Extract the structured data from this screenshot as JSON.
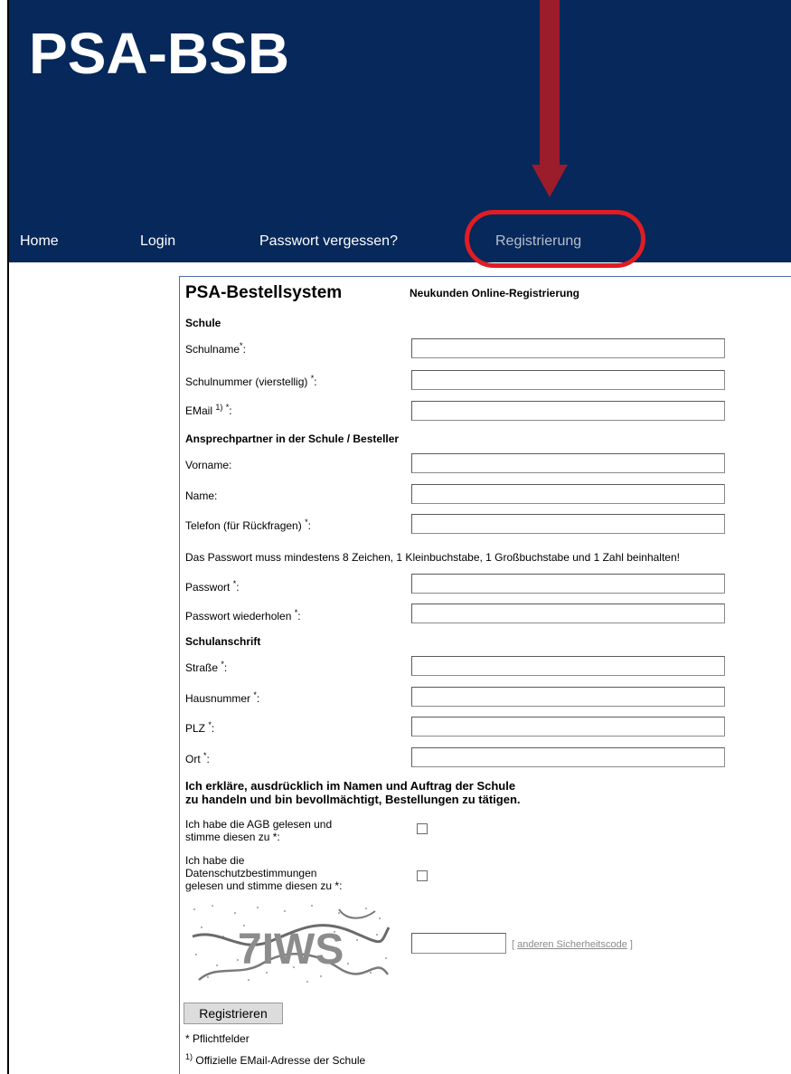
{
  "header": {
    "logo": "PSA-BSB",
    "bg_color": "#06285a",
    "nav": [
      {
        "label": "Home"
      },
      {
        "label": "Login"
      },
      {
        "label": "Passwort vergessen?"
      },
      {
        "label": "Registrierung",
        "active": true
      }
    ]
  },
  "annotation": {
    "arrow_color": "#9b1c2b",
    "ellipse_color": "#e01c24"
  },
  "form": {
    "title": "PSA-Bestellsystem",
    "subtitle": "Neukunden Online-Registrierung",
    "sections": {
      "schule": "Schule",
      "ansprechpartner": "Ansprechpartner in der Schule / Besteller",
      "schulanschrift": "Schulanschrift"
    },
    "fields": {
      "schulname": {
        "label": "Schulname",
        "value": ""
      },
      "schulnummer": {
        "label": "Schulnummer (vierstellig)",
        "value": ""
      },
      "email": {
        "label": "EMail",
        "value": ""
      },
      "vorname": {
        "label": "Vorname:",
        "value": ""
      },
      "name": {
        "label": "Name:",
        "value": ""
      },
      "telefon": {
        "label": "Telefon (für Rückfragen)",
        "value": ""
      },
      "passwort": {
        "label": "Passwort",
        "value": ""
      },
      "passwort2": {
        "label": "Passwort wiederholen",
        "value": ""
      },
      "strasse": {
        "label": "Straße",
        "value": ""
      },
      "hausnummer": {
        "label": "Hausnummer",
        "value": ""
      },
      "plz": {
        "label": "PLZ",
        "value": ""
      },
      "ort": {
        "label": "Ort",
        "value": ""
      }
    },
    "required_marker": "*",
    "email_footnote_ref": "1)",
    "password_hint": "Das Passwort muss mindestens 8 Zeichen, 1 Kleinbuchstabe, 1 Großbuchstabe und 1 Zahl beinhalten!",
    "declaration": {
      "line1": "Ich erkläre, ausdrücklich im Namen und Auftrag der Schule",
      "line2": "zu handeln und bin bevollmächtigt, Bestellungen zu tätigen."
    },
    "agb": {
      "line1": "Ich habe die AGB gelesen und",
      "line2": "stimme diesen zu *:",
      "checked": false
    },
    "datenschutz": {
      "line1": "Ich habe die",
      "line2": "Datenschutzbestimmungen",
      "line3": "gelesen und stimme diesen zu *:",
      "checked": false
    },
    "captcha": {
      "code": "7IWS",
      "input_value": "",
      "refresh_link": "[ anderen Sicherheitscode ]",
      "refresh_link_text": "anderen Sicherheitscode"
    },
    "submit_label": "Registrieren",
    "footnote_required": "* Pflichtfelder",
    "footnote_email_ref": "1)",
    "footnote_email": "Offizielle EMail-Adresse der Schule"
  }
}
